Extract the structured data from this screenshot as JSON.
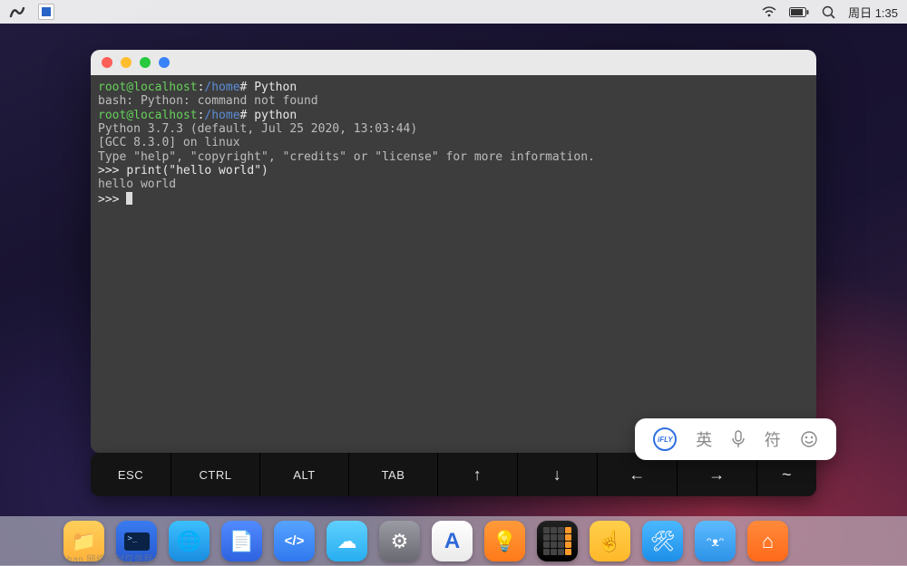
{
  "menubar": {
    "clock": "周日 1:35"
  },
  "terminal": {
    "lines": [
      {
        "prompt_user": "root@localhost",
        "prompt_sep": ":",
        "prompt_path": "/home",
        "prompt_suffix": "# ",
        "cmd": "Python"
      },
      {
        "plain": "bash: Python: command not found"
      },
      {
        "prompt_user": "root@localhost",
        "prompt_sep": ":",
        "prompt_path": "/home",
        "prompt_suffix": "# ",
        "cmd": "python"
      },
      {
        "plain": "Python 3.7.3 (default, Jul 25 2020, 13:03:44)"
      },
      {
        "plain": "[GCC 8.3.0] on linux"
      },
      {
        "plain": "Type \"help\", \"copyright\", \"credits\" or \"license\" for more information."
      },
      {
        "repl": ">>> ",
        "cmd": "print(\"hello world\")"
      },
      {
        "plain": "hello world"
      },
      {
        "repl": ">>> ",
        "cursor": true
      }
    ]
  },
  "keybar": {
    "keys": [
      "ESC",
      "CTRL",
      "ALT",
      "TAB",
      "↑",
      "↓",
      "←",
      "→",
      "~"
    ]
  },
  "ime": {
    "brand": "iFLY",
    "lang": "英",
    "symbols": "符"
  },
  "dock": {
    "items": [
      {
        "name": "files-app",
        "glyph": "📁"
      },
      {
        "name": "terminal-app",
        "glyph": ""
      },
      {
        "name": "browser-app",
        "glyph": "🌐"
      },
      {
        "name": "text-editor-app",
        "glyph": "📄"
      },
      {
        "name": "code-app",
        "glyph": "</>"
      },
      {
        "name": "cloud-app",
        "glyph": "☁"
      },
      {
        "name": "settings-app",
        "glyph": "⚙"
      },
      {
        "name": "store-app",
        "glyph": "A"
      },
      {
        "name": "tips-app",
        "glyph": "💡"
      },
      {
        "name": "calculator-app",
        "glyph": ""
      },
      {
        "name": "hand-app",
        "glyph": "☝"
      },
      {
        "name": "tools-app",
        "glyph": "🛠"
      },
      {
        "name": "cat-app",
        "glyph": "ᵔᴥᵔ"
      },
      {
        "name": "brand-app",
        "glyph": "⌂"
      }
    ]
  },
  "watermark": "oban      网络原创仅供程"
}
